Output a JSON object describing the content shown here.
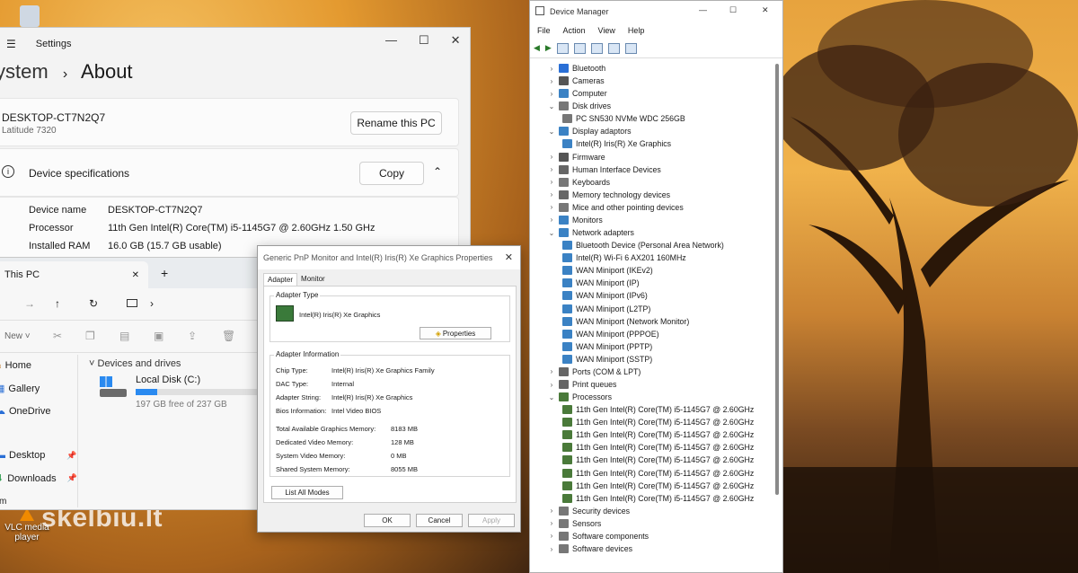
{
  "desktop": {
    "vlc_label": "VLC media player",
    "watermark": "skelbiu.lt"
  },
  "settings": {
    "app_title": "Settings",
    "breadcrumb_parent": "ystem",
    "breadcrumb_current": "About",
    "pc_name": "DESKTOP-CT7N2Q7",
    "pc_model": "Latitude 7320",
    "rename_label": "Rename this PC",
    "specs_title": "Device specifications",
    "copy_label": "Copy",
    "specs": [
      {
        "k": "Device name",
        "v": "DESKTOP-CT7N2Q7"
      },
      {
        "k": "Processor",
        "v": "11th Gen Intel(R) Core(TM) i5-1145G7 @ 2.60GHz   1.50 GHz"
      },
      {
        "k": "Installed RAM",
        "v": "16.0 GB (15.7 GB usable)"
      }
    ]
  },
  "explorer": {
    "tab_title": "This PC",
    "new_label": "New",
    "section_label": "Devices and drives",
    "drive_name": "Local Disk (C:)",
    "drive_free": "197 GB free of 237 GB",
    "drive_used_fraction": 0.17,
    "sidebar": [
      "Home",
      "Gallery",
      "OneDrive",
      "Desktop",
      "Downloads"
    ],
    "footer": "m"
  },
  "props": {
    "title": "Generic PnP Monitor and Intel(R) Iris(R) Xe Graphics Properties",
    "tab_adapter": "Adapter",
    "tab_monitor": "Monitor",
    "adapter_type_legend": "Adapter Type",
    "adapter_name": "Intel(R) Iris(R) Xe Graphics",
    "properties_label": "Properties",
    "info_legend": "Adapter Information",
    "info": [
      {
        "k": "Chip Type:",
        "v": "Intel(R) Iris(R) Xe Graphics Family"
      },
      {
        "k": "DAC Type:",
        "v": "Internal"
      },
      {
        "k": "Adapter String:",
        "v": "Intel(R) Iris(R) Xe Graphics"
      },
      {
        "k": "Bios Information:",
        "v": "Intel Video BIOS"
      }
    ],
    "memory": [
      {
        "k": "Total Available Graphics Memory:",
        "v": "8183 MB"
      },
      {
        "k": "Dedicated Video Memory:",
        "v": "128 MB"
      },
      {
        "k": "System Video Memory:",
        "v": "0 MB"
      },
      {
        "k": "Shared System Memory:",
        "v": "8055 MB"
      }
    ],
    "list_modes_label": "List All Modes",
    "ok_label": "OK",
    "cancel_label": "Cancel",
    "apply_label": "Apply"
  },
  "devmgr": {
    "title": "Device Manager",
    "menu": [
      "File",
      "Action",
      "View",
      "Help"
    ],
    "tree": [
      {
        "label": "Bluetooth",
        "lvl": 0,
        "exp": ">",
        "color": "#2a6fd6"
      },
      {
        "label": "Cameras",
        "lvl": 0,
        "exp": ">",
        "color": "#555555"
      },
      {
        "label": "Computer",
        "lvl": 0,
        "exp": ">",
        "color": "#3b82c4"
      },
      {
        "label": "Disk drives",
        "lvl": 0,
        "exp": "v",
        "color": "#777777"
      },
      {
        "label": "PC SN530 NVMe WDC 256GB",
        "lvl": 1,
        "exp": "",
        "color": "#777777"
      },
      {
        "label": "Display adaptors",
        "lvl": 0,
        "exp": "v",
        "color": "#3b82c4"
      },
      {
        "label": "Intel(R) Iris(R) Xe Graphics",
        "lvl": 1,
        "exp": "",
        "color": "#3b82c4"
      },
      {
        "label": "Firmware",
        "lvl": 0,
        "exp": ">",
        "color": "#555555"
      },
      {
        "label": "Human Interface Devices",
        "lvl": 0,
        "exp": ">",
        "color": "#666666"
      },
      {
        "label": "Keyboards",
        "lvl": 0,
        "exp": ">",
        "color": "#777777"
      },
      {
        "label": "Memory technology devices",
        "lvl": 0,
        "exp": ">",
        "color": "#666666"
      },
      {
        "label": "Mice and other pointing devices",
        "lvl": 0,
        "exp": ">",
        "color": "#777777"
      },
      {
        "label": "Monitors",
        "lvl": 0,
        "exp": ">",
        "color": "#3b82c4"
      },
      {
        "label": "Network adapters",
        "lvl": 0,
        "exp": "v",
        "color": "#3b82c4"
      },
      {
        "label": "Bluetooth Device (Personal Area Network)",
        "lvl": 1,
        "exp": "",
        "color": "#3b82c4"
      },
      {
        "label": "Intel(R) Wi-Fi 6 AX201 160MHz",
        "lvl": 1,
        "exp": "",
        "color": "#3b82c4"
      },
      {
        "label": "WAN Miniport (IKEv2)",
        "lvl": 1,
        "exp": "",
        "color": "#3b82c4"
      },
      {
        "label": "WAN Miniport (IP)",
        "lvl": 1,
        "exp": "",
        "color": "#3b82c4"
      },
      {
        "label": "WAN Miniport (IPv6)",
        "lvl": 1,
        "exp": "",
        "color": "#3b82c4"
      },
      {
        "label": "WAN Miniport (L2TP)",
        "lvl": 1,
        "exp": "",
        "color": "#3b82c4"
      },
      {
        "label": "WAN Miniport (Network Monitor)",
        "lvl": 1,
        "exp": "",
        "color": "#3b82c4"
      },
      {
        "label": "WAN Miniport (PPPOE)",
        "lvl": 1,
        "exp": "",
        "color": "#3b82c4"
      },
      {
        "label": "WAN Miniport (PPTP)",
        "lvl": 1,
        "exp": "",
        "color": "#3b82c4"
      },
      {
        "label": "WAN Miniport (SSTP)",
        "lvl": 1,
        "exp": "",
        "color": "#3b82c4"
      },
      {
        "label": "Ports (COM & LPT)",
        "lvl": 0,
        "exp": ">",
        "color": "#666666"
      },
      {
        "label": "Print queues",
        "lvl": 0,
        "exp": ">",
        "color": "#666666"
      },
      {
        "label": "Processors",
        "lvl": 0,
        "exp": "v",
        "color": "#4a7a3a"
      },
      {
        "label": "11th Gen Intel(R) Core(TM) i5-1145G7 @ 2.60GHz",
        "lvl": 1,
        "exp": "",
        "color": "#4a7a3a"
      },
      {
        "label": "11th Gen Intel(R) Core(TM) i5-1145G7 @ 2.60GHz",
        "lvl": 1,
        "exp": "",
        "color": "#4a7a3a"
      },
      {
        "label": "11th Gen Intel(R) Core(TM) i5-1145G7 @ 2.60GHz",
        "lvl": 1,
        "exp": "",
        "color": "#4a7a3a"
      },
      {
        "label": "11th Gen Intel(R) Core(TM) i5-1145G7 @ 2.60GHz",
        "lvl": 1,
        "exp": "",
        "color": "#4a7a3a"
      },
      {
        "label": "11th Gen Intel(R) Core(TM) i5-1145G7 @ 2.60GHz",
        "lvl": 1,
        "exp": "",
        "color": "#4a7a3a"
      },
      {
        "label": "11th Gen Intel(R) Core(TM) i5-1145G7 @ 2.60GHz",
        "lvl": 1,
        "exp": "",
        "color": "#4a7a3a"
      },
      {
        "label": "11th Gen Intel(R) Core(TM) i5-1145G7 @ 2.60GHz",
        "lvl": 1,
        "exp": "",
        "color": "#4a7a3a"
      },
      {
        "label": "11th Gen Intel(R) Core(TM) i5-1145G7 @ 2.60GHz",
        "lvl": 1,
        "exp": "",
        "color": "#4a7a3a"
      },
      {
        "label": "Security devices",
        "lvl": 0,
        "exp": ">",
        "color": "#777777"
      },
      {
        "label": "Sensors",
        "lvl": 0,
        "exp": ">",
        "color": "#777777"
      },
      {
        "label": "Software components",
        "lvl": 0,
        "exp": ">",
        "color": "#777777"
      },
      {
        "label": "Software devices",
        "lvl": 0,
        "exp": ">",
        "color": "#777777"
      }
    ]
  }
}
